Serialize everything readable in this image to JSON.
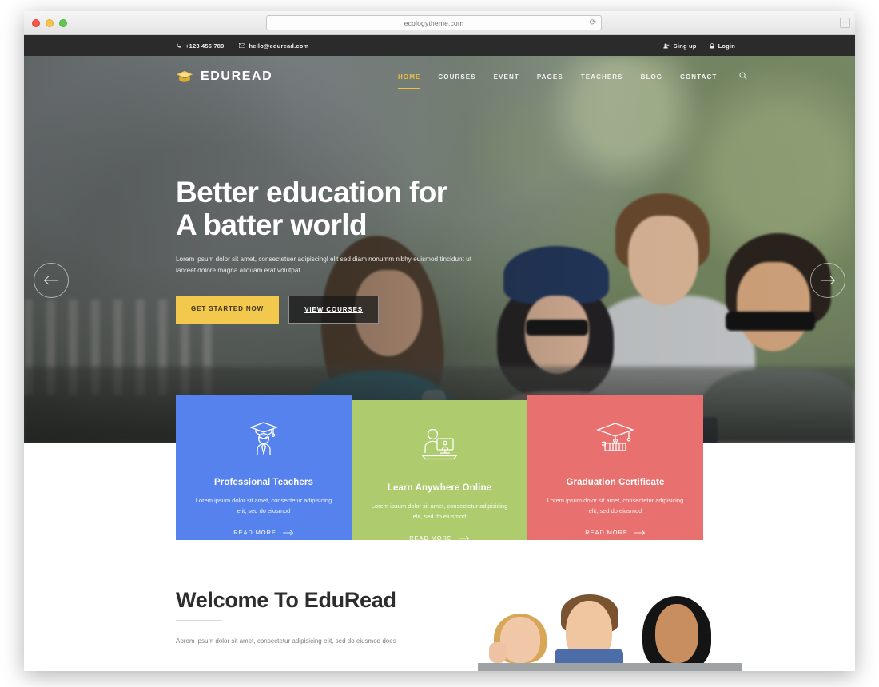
{
  "browser": {
    "url": "ecologytheme.com",
    "reload_icon": "reload-icon",
    "new_tab_label": "+"
  },
  "topbar": {
    "phone": "+123 456 789",
    "email": "hello@eduread.com",
    "signup_label": "Sing up",
    "login_label": "Login",
    "background": "#2b2b2b"
  },
  "header": {
    "logo_text": "EDUREAD",
    "logo_icon": "graduation-cap-icon",
    "accent": "#f0c040",
    "nav": [
      {
        "label": "HOME",
        "active": true
      },
      {
        "label": "COURSES",
        "active": false
      },
      {
        "label": "EVENT",
        "active": false
      },
      {
        "label": "PAGES",
        "active": false
      },
      {
        "label": "TEACHERS",
        "active": false
      },
      {
        "label": "BLOG",
        "active": false
      },
      {
        "label": "CONTACT",
        "active": false
      }
    ],
    "search_icon": "search-icon"
  },
  "hero": {
    "heading_line1": "Better education for",
    "heading_line2": "A batter world",
    "paragraph": "Lorem ipsum dolor sit amet, consectetuer adipiscingl elit sed diam nonumm nibhy euismod tincidunt ut laoreet dolore magna aliquam erat volutpat.",
    "primary_button": "GET STARTED NOW",
    "secondary_button": "VIEW COURSES",
    "primary_color": "#f2c94c",
    "prev_icon": "arrow-left-icon",
    "next_icon": "arrow-right-icon"
  },
  "features": [
    {
      "title": "Professional Teachers",
      "text": "Lorem ipsum dolor sit amet, consectetur adipisicing elit, sed do eiusmod",
      "more_label": "READ MORE",
      "color": "#5682ed",
      "icon": "graduate-teacher-icon"
    },
    {
      "title": "Learn Anywhere Online",
      "text": "Lorem ipsum dolor sit amet, consectetur adipisicing elit, sed do eiusmod",
      "more_label": "READ MORE",
      "color": "#aecb6e",
      "icon": "online-learning-icon"
    },
    {
      "title": "Graduation Certificate",
      "text": "Lorem ipsum dolor sit amet, consectetur adipisicing elit, sed do eiusmod",
      "more_label": "READ MORE",
      "color": "#e8706e",
      "icon": "diploma-cap-icon"
    }
  ],
  "welcome": {
    "heading": "Welcome To EduRead",
    "paragraph": "Aorem ipsum dolor sit amet, consectetur adipisicing elit, sed do eiusmod does",
    "photo_alt": "three-students-photo"
  }
}
